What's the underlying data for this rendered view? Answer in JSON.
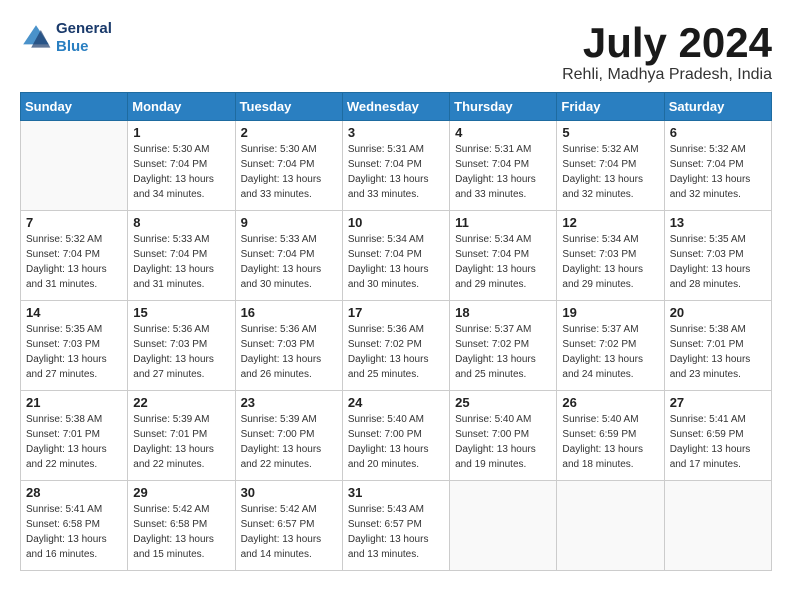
{
  "header": {
    "logo_line1": "General",
    "logo_line2": "Blue",
    "month_year": "July 2024",
    "location": "Rehli, Madhya Pradesh, India"
  },
  "weekdays": [
    "Sunday",
    "Monday",
    "Tuesday",
    "Wednesday",
    "Thursday",
    "Friday",
    "Saturday"
  ],
  "weeks": [
    [
      {
        "day": "",
        "info": ""
      },
      {
        "day": "1",
        "info": "Sunrise: 5:30 AM\nSunset: 7:04 PM\nDaylight: 13 hours\nand 34 minutes."
      },
      {
        "day": "2",
        "info": "Sunrise: 5:30 AM\nSunset: 7:04 PM\nDaylight: 13 hours\nand 33 minutes."
      },
      {
        "day": "3",
        "info": "Sunrise: 5:31 AM\nSunset: 7:04 PM\nDaylight: 13 hours\nand 33 minutes."
      },
      {
        "day": "4",
        "info": "Sunrise: 5:31 AM\nSunset: 7:04 PM\nDaylight: 13 hours\nand 33 minutes."
      },
      {
        "day": "5",
        "info": "Sunrise: 5:32 AM\nSunset: 7:04 PM\nDaylight: 13 hours\nand 32 minutes."
      },
      {
        "day": "6",
        "info": "Sunrise: 5:32 AM\nSunset: 7:04 PM\nDaylight: 13 hours\nand 32 minutes."
      }
    ],
    [
      {
        "day": "7",
        "info": "Sunrise: 5:32 AM\nSunset: 7:04 PM\nDaylight: 13 hours\nand 31 minutes."
      },
      {
        "day": "8",
        "info": "Sunrise: 5:33 AM\nSunset: 7:04 PM\nDaylight: 13 hours\nand 31 minutes."
      },
      {
        "day": "9",
        "info": "Sunrise: 5:33 AM\nSunset: 7:04 PM\nDaylight: 13 hours\nand 30 minutes."
      },
      {
        "day": "10",
        "info": "Sunrise: 5:34 AM\nSunset: 7:04 PM\nDaylight: 13 hours\nand 30 minutes."
      },
      {
        "day": "11",
        "info": "Sunrise: 5:34 AM\nSunset: 7:04 PM\nDaylight: 13 hours\nand 29 minutes."
      },
      {
        "day": "12",
        "info": "Sunrise: 5:34 AM\nSunset: 7:03 PM\nDaylight: 13 hours\nand 29 minutes."
      },
      {
        "day": "13",
        "info": "Sunrise: 5:35 AM\nSunset: 7:03 PM\nDaylight: 13 hours\nand 28 minutes."
      }
    ],
    [
      {
        "day": "14",
        "info": "Sunrise: 5:35 AM\nSunset: 7:03 PM\nDaylight: 13 hours\nand 27 minutes."
      },
      {
        "day": "15",
        "info": "Sunrise: 5:36 AM\nSunset: 7:03 PM\nDaylight: 13 hours\nand 27 minutes."
      },
      {
        "day": "16",
        "info": "Sunrise: 5:36 AM\nSunset: 7:03 PM\nDaylight: 13 hours\nand 26 minutes."
      },
      {
        "day": "17",
        "info": "Sunrise: 5:36 AM\nSunset: 7:02 PM\nDaylight: 13 hours\nand 25 minutes."
      },
      {
        "day": "18",
        "info": "Sunrise: 5:37 AM\nSunset: 7:02 PM\nDaylight: 13 hours\nand 25 minutes."
      },
      {
        "day": "19",
        "info": "Sunrise: 5:37 AM\nSunset: 7:02 PM\nDaylight: 13 hours\nand 24 minutes."
      },
      {
        "day": "20",
        "info": "Sunrise: 5:38 AM\nSunset: 7:01 PM\nDaylight: 13 hours\nand 23 minutes."
      }
    ],
    [
      {
        "day": "21",
        "info": "Sunrise: 5:38 AM\nSunset: 7:01 PM\nDaylight: 13 hours\nand 22 minutes."
      },
      {
        "day": "22",
        "info": "Sunrise: 5:39 AM\nSunset: 7:01 PM\nDaylight: 13 hours\nand 22 minutes."
      },
      {
        "day": "23",
        "info": "Sunrise: 5:39 AM\nSunset: 7:00 PM\nDaylight: 13 hours\nand 22 minutes."
      },
      {
        "day": "24",
        "info": "Sunrise: 5:40 AM\nSunset: 7:00 PM\nDaylight: 13 hours\nand 20 minutes."
      },
      {
        "day": "25",
        "info": "Sunrise: 5:40 AM\nSunset: 7:00 PM\nDaylight: 13 hours\nand 19 minutes."
      },
      {
        "day": "26",
        "info": "Sunrise: 5:40 AM\nSunset: 6:59 PM\nDaylight: 13 hours\nand 18 minutes."
      },
      {
        "day": "27",
        "info": "Sunrise: 5:41 AM\nSunset: 6:59 PM\nDaylight: 13 hours\nand 17 minutes."
      }
    ],
    [
      {
        "day": "28",
        "info": "Sunrise: 5:41 AM\nSunset: 6:58 PM\nDaylight: 13 hours\nand 16 minutes."
      },
      {
        "day": "29",
        "info": "Sunrise: 5:42 AM\nSunset: 6:58 PM\nDaylight: 13 hours\nand 15 minutes."
      },
      {
        "day": "30",
        "info": "Sunrise: 5:42 AM\nSunset: 6:57 PM\nDaylight: 13 hours\nand 14 minutes."
      },
      {
        "day": "31",
        "info": "Sunrise: 5:43 AM\nSunset: 6:57 PM\nDaylight: 13 hours\nand 13 minutes."
      },
      {
        "day": "",
        "info": ""
      },
      {
        "day": "",
        "info": ""
      },
      {
        "day": "",
        "info": ""
      }
    ]
  ]
}
